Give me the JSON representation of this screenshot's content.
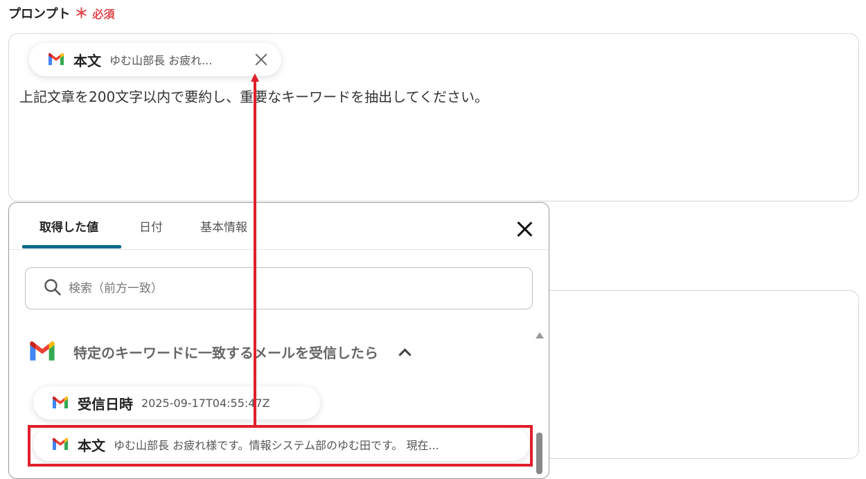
{
  "prompt": {
    "label": "プロンプト",
    "required_mark": "＊",
    "required_text": "必須",
    "chip": {
      "title": "本文",
      "value": "ゆむ山部長 お疲れ..."
    },
    "text": "上記文章を200文字以内で要約し、重要なキーワードを抽出してください。"
  },
  "panel": {
    "tabs": [
      {
        "label": "取得した値",
        "active": true
      },
      {
        "label": "日付",
        "active": false
      },
      {
        "label": "基本情報",
        "active": false
      }
    ],
    "search": {
      "placeholder": "検索（前方一致）",
      "value": ""
    },
    "group": {
      "title": "特定のキーワードに一致するメールを受信したら",
      "expanded": true
    },
    "items": [
      {
        "title": "受信日時",
        "value": "2025-09-17T04:55:47Z"
      },
      {
        "title": "本文",
        "value": "ゆむ山部長 お疲れ様です。情報システム部のゆむ田です。 現在..."
      }
    ]
  },
  "colors": {
    "accent": "#0c6a8c",
    "required": "#e5484d",
    "highlight": "#e01e2b"
  },
  "icons": [
    "gmail-icon",
    "close-icon",
    "search-icon",
    "chevron-up-icon"
  ]
}
